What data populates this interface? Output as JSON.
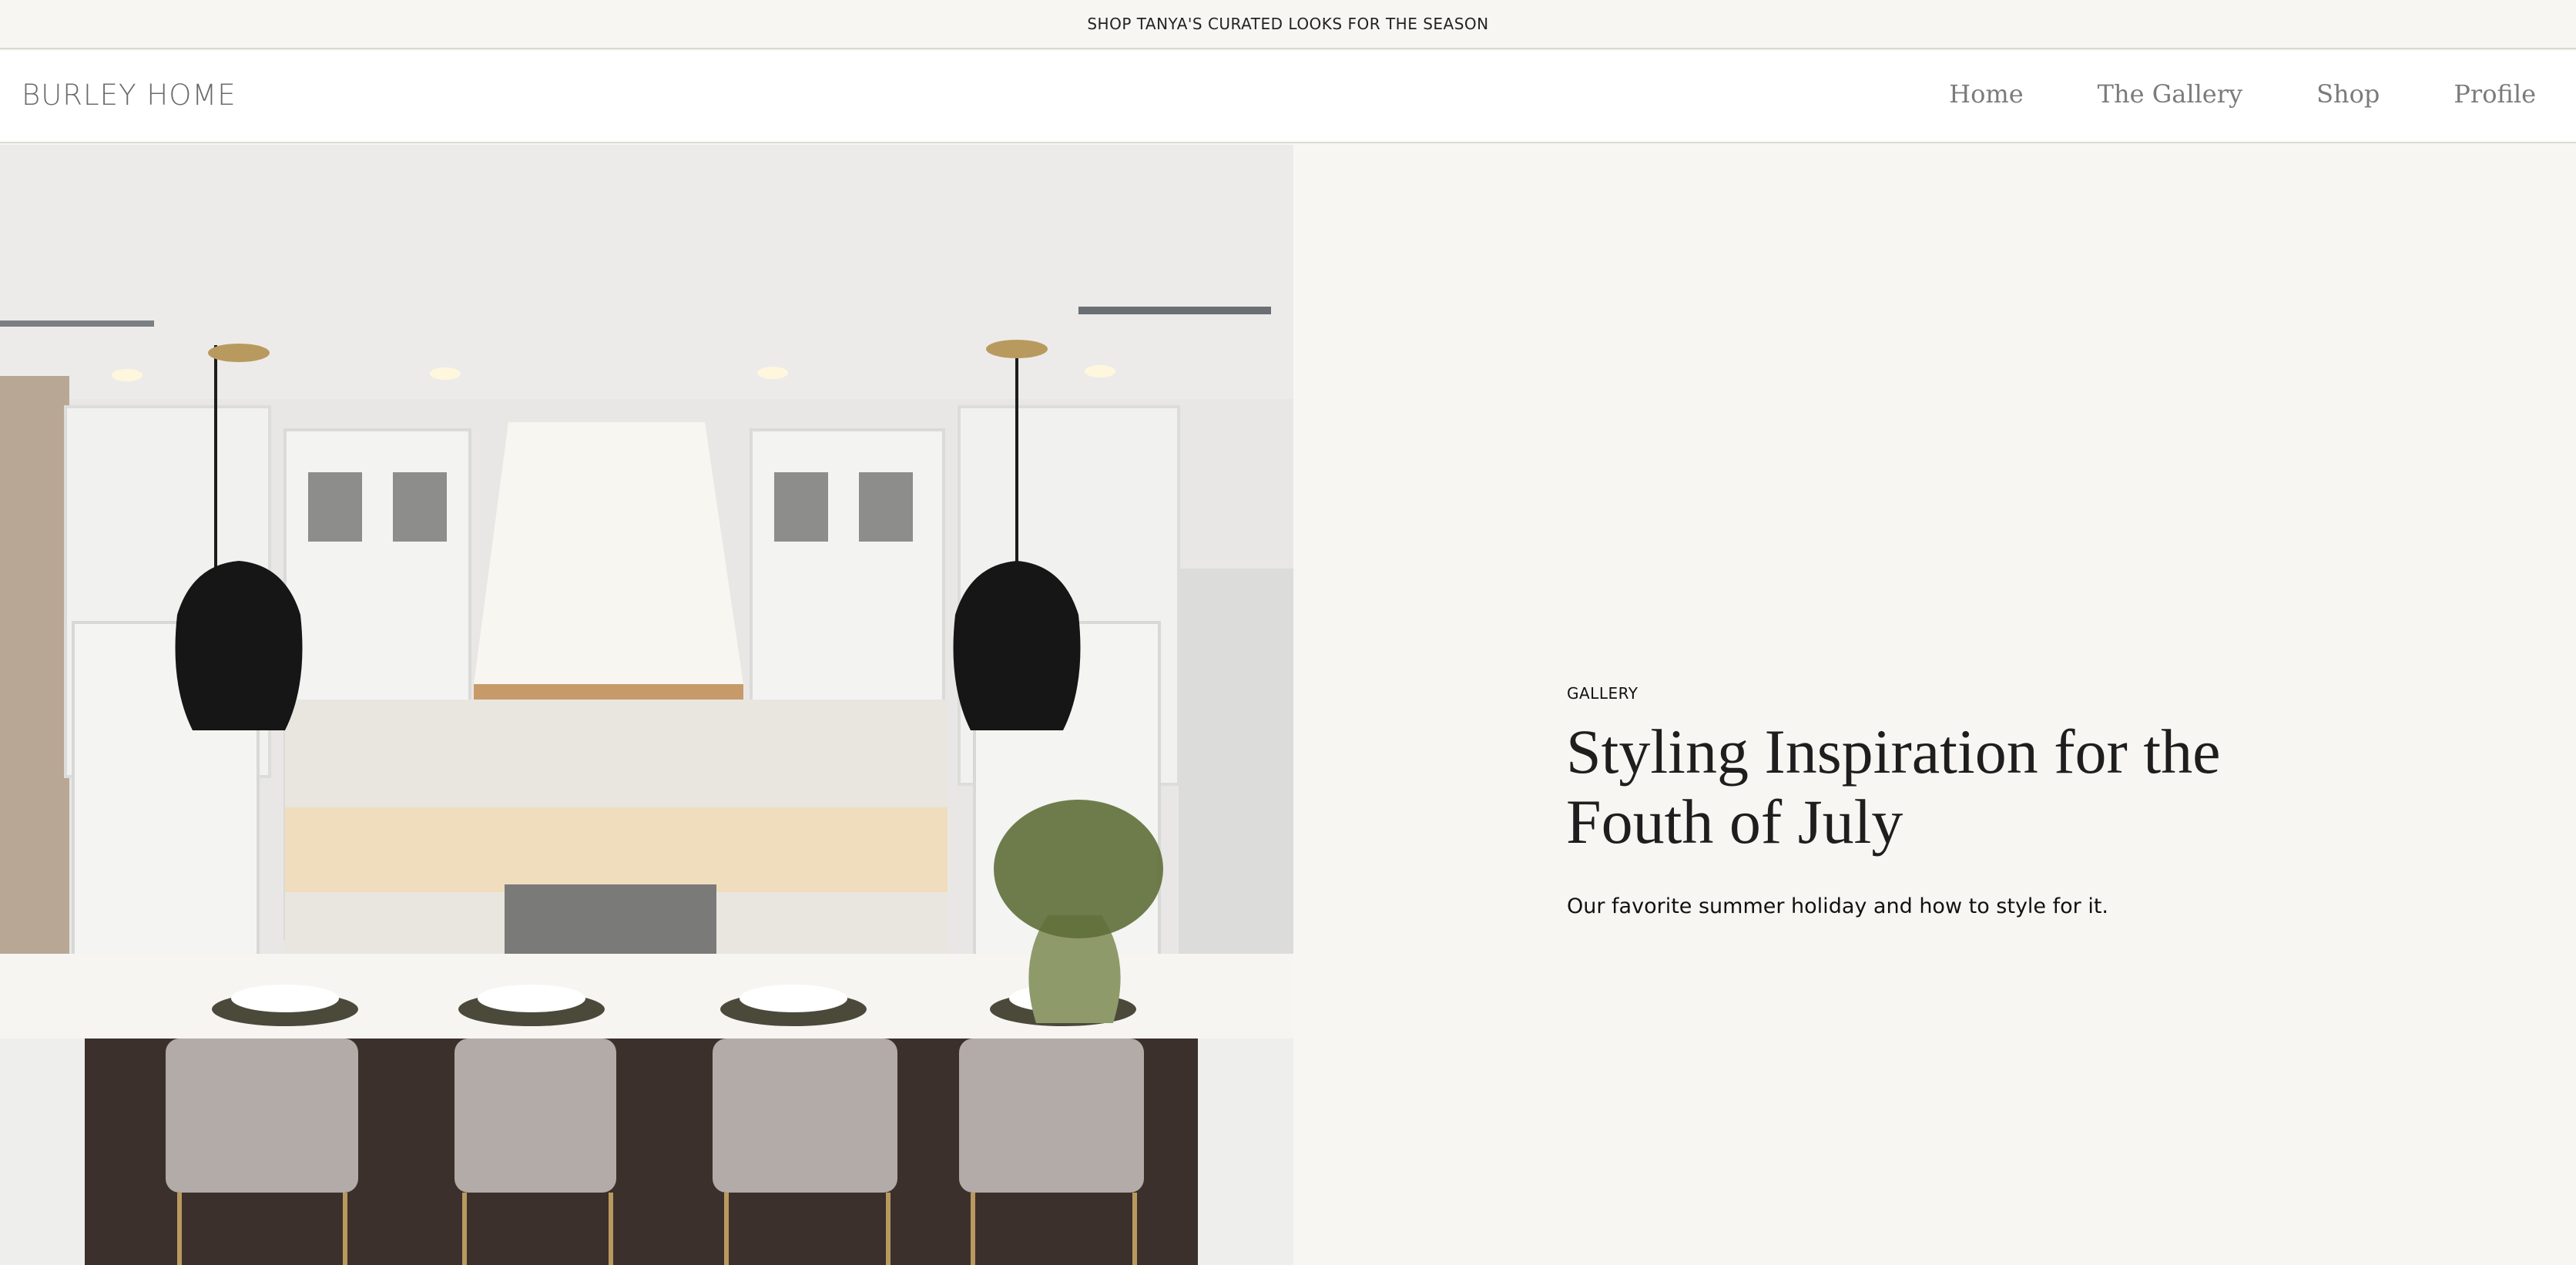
{
  "announcement": {
    "text": "SHOP TANYA'S CURATED LOOKS FOR THE SEASON"
  },
  "header": {
    "brand": "BURLEY HOME",
    "nav": [
      "Home",
      "The Gallery",
      "Shop",
      "Profile"
    ]
  },
  "hero": {
    "image_subject": "kitchen-interior-photo",
    "eyebrow": "GALLERY",
    "title": "Styling Inspiration for the Fouth of July",
    "subtitle": "Our favorite summer holiday and how to style for it."
  },
  "colors": {
    "page_background": "#f7f6f2",
    "header_background": "#ffffff",
    "nav_text": "#7b7b7b",
    "title_text": "#1e1e1e"
  }
}
